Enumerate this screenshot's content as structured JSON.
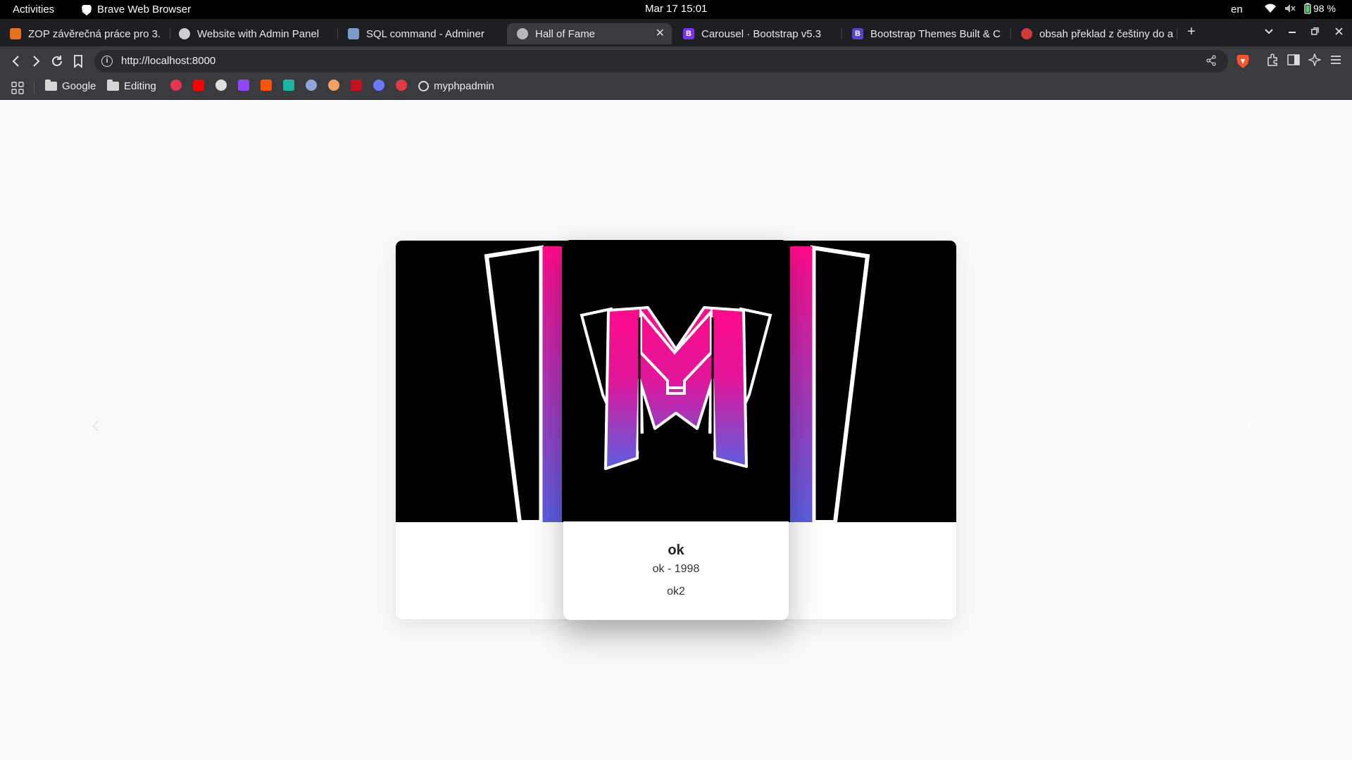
{
  "system": {
    "activities": "Activities",
    "app_name": "Brave Web Browser",
    "clock": "Mar 17  15:01",
    "language": "en",
    "battery": "98 %"
  },
  "tabs": [
    {
      "label": "ZOP závěrečná práce pro 3.",
      "favicon_color": "#e8711a",
      "active": false
    },
    {
      "label": "Website with Admin Panel",
      "favicon_color": "#cfcfcf",
      "active": false
    },
    {
      "label": "SQL command - Adminer",
      "favicon_color": "#7a9cc6",
      "active": false
    },
    {
      "label": "Hall of Fame",
      "favicon_color": "#b8b8b8",
      "active": true
    },
    {
      "label": "Carousel · Bootstrap v5.3",
      "favicon_color": "#7b2ff7",
      "active": false
    },
    {
      "label": "Bootstrap Themes Built & C",
      "favicon_color": "#5b3fd4",
      "active": false
    },
    {
      "label": "obsah překlad z češtiny do a",
      "favicon_color": "#d03a3a",
      "active": false
    }
  ],
  "tab_favicon_letters": [
    "",
    "",
    "",
    "",
    "B",
    "B",
    ""
  ],
  "address": {
    "url": "http://localhost:8000"
  },
  "bookmarks": {
    "items": [
      {
        "label": "Google",
        "type": "folder"
      },
      {
        "label": "Editing",
        "type": "folder"
      },
      {
        "label": "myphpadmin",
        "type": "link"
      }
    ],
    "icon_colors": [
      "#e8344f",
      "#ff0000",
      "#e0e0e0",
      "#9146ff",
      "#ff5500",
      "#18b5a4",
      "#8fa4d8",
      "#f4a261",
      "#c1121f",
      "#6a7bff",
      "#e63946"
    ]
  },
  "carousel": {
    "active_card": {
      "title": "ok",
      "subtitle": "ok - 1998",
      "description": "ok2"
    },
    "colors": {
      "gradient_top": "#ff0a8a",
      "gradient_bottom": "#5a5fe0",
      "frame": "#ffffff",
      "background": "#000000"
    }
  }
}
